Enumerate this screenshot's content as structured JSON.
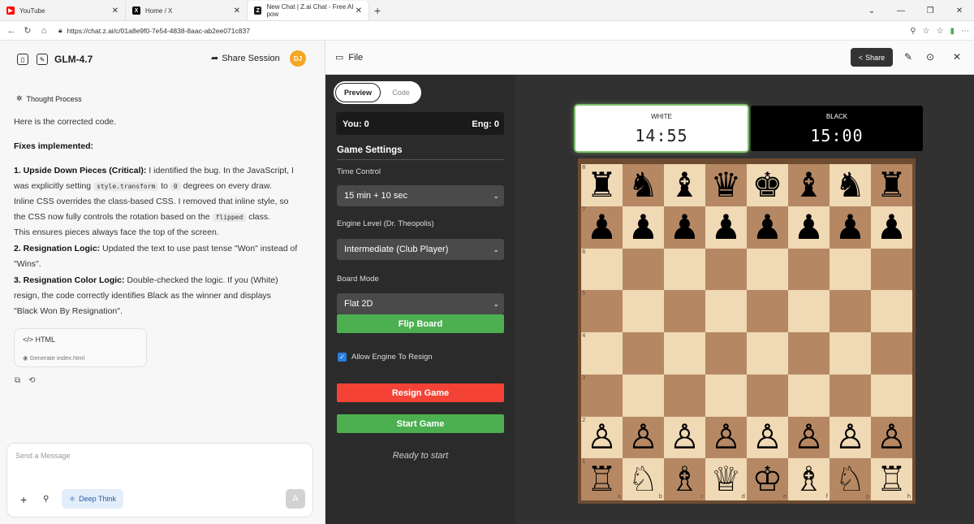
{
  "browser": {
    "tabs": [
      {
        "label": "YouTube",
        "favicon_color": "#ff0000",
        "favicon_glyph": "▶"
      },
      {
        "label": "Home / X",
        "favicon_color": "#000000",
        "favicon_glyph": "X"
      },
      {
        "label": "New Chat | Z.ai Chat - Free AI pow",
        "favicon_color": "#1a1a1a",
        "favicon_glyph": "Z"
      }
    ],
    "new_tab": "+",
    "url": "https://chat.z.ai/c/01a8e9f0-7e54-4838-8aac-ab2ee071c837"
  },
  "chat": {
    "model": "GLM-4.7",
    "share_session": "Share Session",
    "avatar_initials": "DJ",
    "thought_process": "Thought Process",
    "intro": "Here is the corrected code.",
    "fixes_heading": "Fixes implemented:",
    "fix1_title": "1. Upside Down Pieces (Critical):",
    "fix1_a": " I identified the bug. In the JavaScript, I",
    "fix1_b": "was explicitly setting ",
    "fix1_code1": "style.transform",
    "fix1_c": " to ",
    "fix1_code2": "0",
    "fix1_d": " degrees on every draw.",
    "fix1_e": "Inline CSS overrides the class-based CSS. I removed that inline style, so",
    "fix1_f": "the CSS now fully controls the rotation based on the ",
    "fix1_code3": "flipped",
    "fix1_g": " class.",
    "fix1_h": "This ensures pieces always face the top of the screen.",
    "fix2_title": "2. Resignation Logic:",
    "fix2_a": " Updated the text to use past tense \"Won\" instead of",
    "fix2_b": "\"Wins\".",
    "fix3_title": "3. Resignation Color Logic:",
    "fix3_a": " Double-checked the logic. If you (White)",
    "fix3_b": "resign, the code correctly identifies Black as the winner and displays",
    "fix3_c": "\"Black Won By Resignation\".",
    "file_card_title": "HTML",
    "file_card_sub": "Generate index.html",
    "input_placeholder": "Send a Message",
    "deep_think": "Deep Think",
    "send_glyph": "A"
  },
  "artifact": {
    "file_label": "File",
    "share": "Share",
    "tab_preview": "Preview",
    "tab_code": "Code",
    "you_score": "You: 0",
    "eng_score": "Eng: 0",
    "settings_title": "Game Settings",
    "time_control_label": "Time Control",
    "time_control_value": "15 min + 10 sec",
    "engine_level_label": "Engine Level (Dr. Theopolis)",
    "engine_level_value": "Intermediate (Club Player)",
    "board_mode_label": "Board Mode",
    "board_mode_value": "Flat 2D",
    "flip_board": "Flip Board",
    "allow_resign": "Allow Engine To Resign",
    "resign_game": "Resign Game",
    "start_game": "Start Game",
    "status": "Ready to start"
  },
  "clocks": {
    "white_label": "WHITE",
    "white_time": "14:55",
    "black_label": "BLACK",
    "black_time": "15:00"
  },
  "board": {
    "ranks": [
      "8",
      "7",
      "6",
      "5",
      "4",
      "3",
      "2",
      "1"
    ],
    "files": [
      "a",
      "b",
      "c",
      "d",
      "e",
      "f",
      "g",
      "h"
    ],
    "position": [
      [
        "♜",
        "♞",
        "♝",
        "♛",
        "♚",
        "♝",
        "♞",
        "♜"
      ],
      [
        "♟",
        "♟",
        "♟",
        "♟",
        "♟",
        "♟",
        "♟",
        "♟"
      ],
      [
        "",
        "",
        "",
        "",
        "",
        "",
        "",
        ""
      ],
      [
        "",
        "",
        "",
        "",
        "",
        "",
        "",
        ""
      ],
      [
        "",
        "",
        "",
        "",
        "",
        "",
        "",
        ""
      ],
      [
        "",
        "",
        "",
        "",
        "",
        "",
        "",
        ""
      ],
      [
        "♙",
        "♙",
        "♙",
        "♙",
        "♙",
        "♙",
        "♙",
        "♙"
      ],
      [
        "♖",
        "♘",
        "♗",
        "♕",
        "♔",
        "♗",
        "♘",
        "♖"
      ]
    ]
  },
  "colors": {
    "light_square": "#f0d9b5",
    "dark_square": "#b58863",
    "green_button": "#4caf50",
    "red_button": "#f44336",
    "avatar": "#f5a623"
  }
}
